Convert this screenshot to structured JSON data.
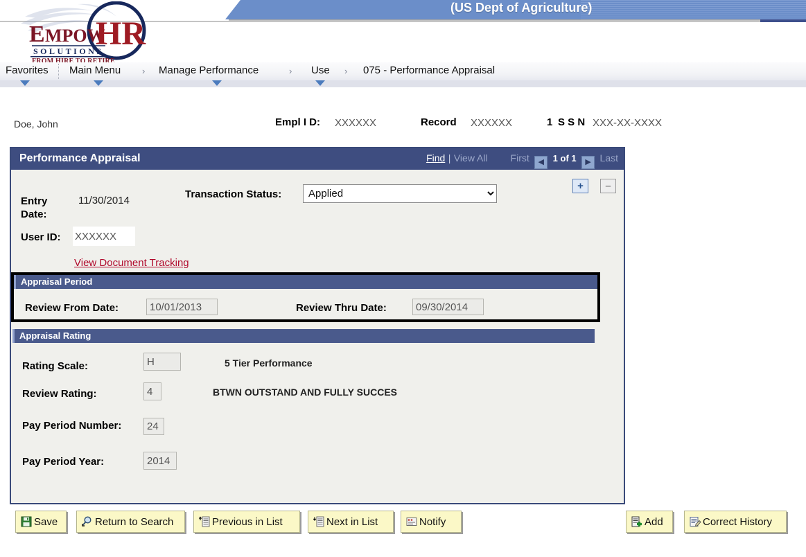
{
  "header": {
    "agency_title": "(US Dept of Agriculture)",
    "logo_main": "EMPOW",
    "logo_hr": "HR",
    "logo_sub": "S O L U T I O N S",
    "logo_tag": "FROM HIRE TO RETIRE"
  },
  "breadcrumb": {
    "items": [
      {
        "label": "Favorites",
        "has_menu": true
      },
      {
        "label": "Main Menu",
        "has_menu": true
      },
      {
        "label": "Manage Performance",
        "has_menu": true
      },
      {
        "label": "Use",
        "has_menu": true
      },
      {
        "label": "075 - Performance Appraisal",
        "has_menu": false
      }
    ],
    "separator": "›"
  },
  "employee": {
    "name": "Doe, John",
    "empl_id_label": "Empl I D:",
    "empl_id_value": "XXXXXX",
    "record_label": "Record",
    "record_value": "XXXXXX",
    "ssn_number": "1",
    "ssn_label": "S S N",
    "ssn_value": "XXX-XX-XXXX"
  },
  "panel": {
    "title": "Performance Appraisal",
    "nav": {
      "find": "Find",
      "pipe": "|",
      "view_all": "View All",
      "first": "First",
      "prev_arrow": "◀",
      "counter": "1 of 1",
      "next_arrow": "▶",
      "last": "Last"
    },
    "add_row_label": "+",
    "delete_row_label": "–",
    "fields": {
      "entry_date_label": "Entry Date:",
      "entry_date_value": "11/30/2014",
      "transaction_status_label": "Transaction Status:",
      "transaction_status_value": "Applied",
      "transaction_status_options": [
        "Applied"
      ],
      "user_id_label": "User ID:",
      "user_id_value": "XXXXXX",
      "view_document_tracking": "View Document Tracking"
    },
    "appraisal_period": {
      "header": "Appraisal Period",
      "review_from_label": "Review From Date:",
      "review_from_value": "10/01/2013",
      "review_thru_label": "Review Thru Date:",
      "review_thru_value": "09/30/2014"
    },
    "appraisal_rating": {
      "header": "Appraisal Rating",
      "rating_scale_label": "Rating Scale:",
      "rating_scale_value": "H",
      "rating_scale_desc": "5 Tier Performance",
      "review_rating_label": "Review Rating:",
      "review_rating_value": "4",
      "review_rating_desc": "BTWN OUTSTAND AND FULLY SUCCES",
      "pay_period_number_label": "Pay Period Number:",
      "pay_period_number_value": "24",
      "pay_period_year_label": "Pay Period Year:",
      "pay_period_year_value": "2014"
    }
  },
  "toolbar": {
    "save": "Save",
    "return_to_search": "Return to Search",
    "previous_in_list": "Previous in List",
    "next_in_list": "Next in List",
    "notify": "Notify",
    "add": "Add",
    "correct_history": "Correct History"
  },
  "colors": {
    "banner_blue": "#6b8ec9",
    "panel_header": "#3e4d80",
    "group_header": "#4a5a8c",
    "link_red": "#b0072a",
    "button_yellow": "#fbf8c7",
    "highlight_border": "#000000"
  }
}
